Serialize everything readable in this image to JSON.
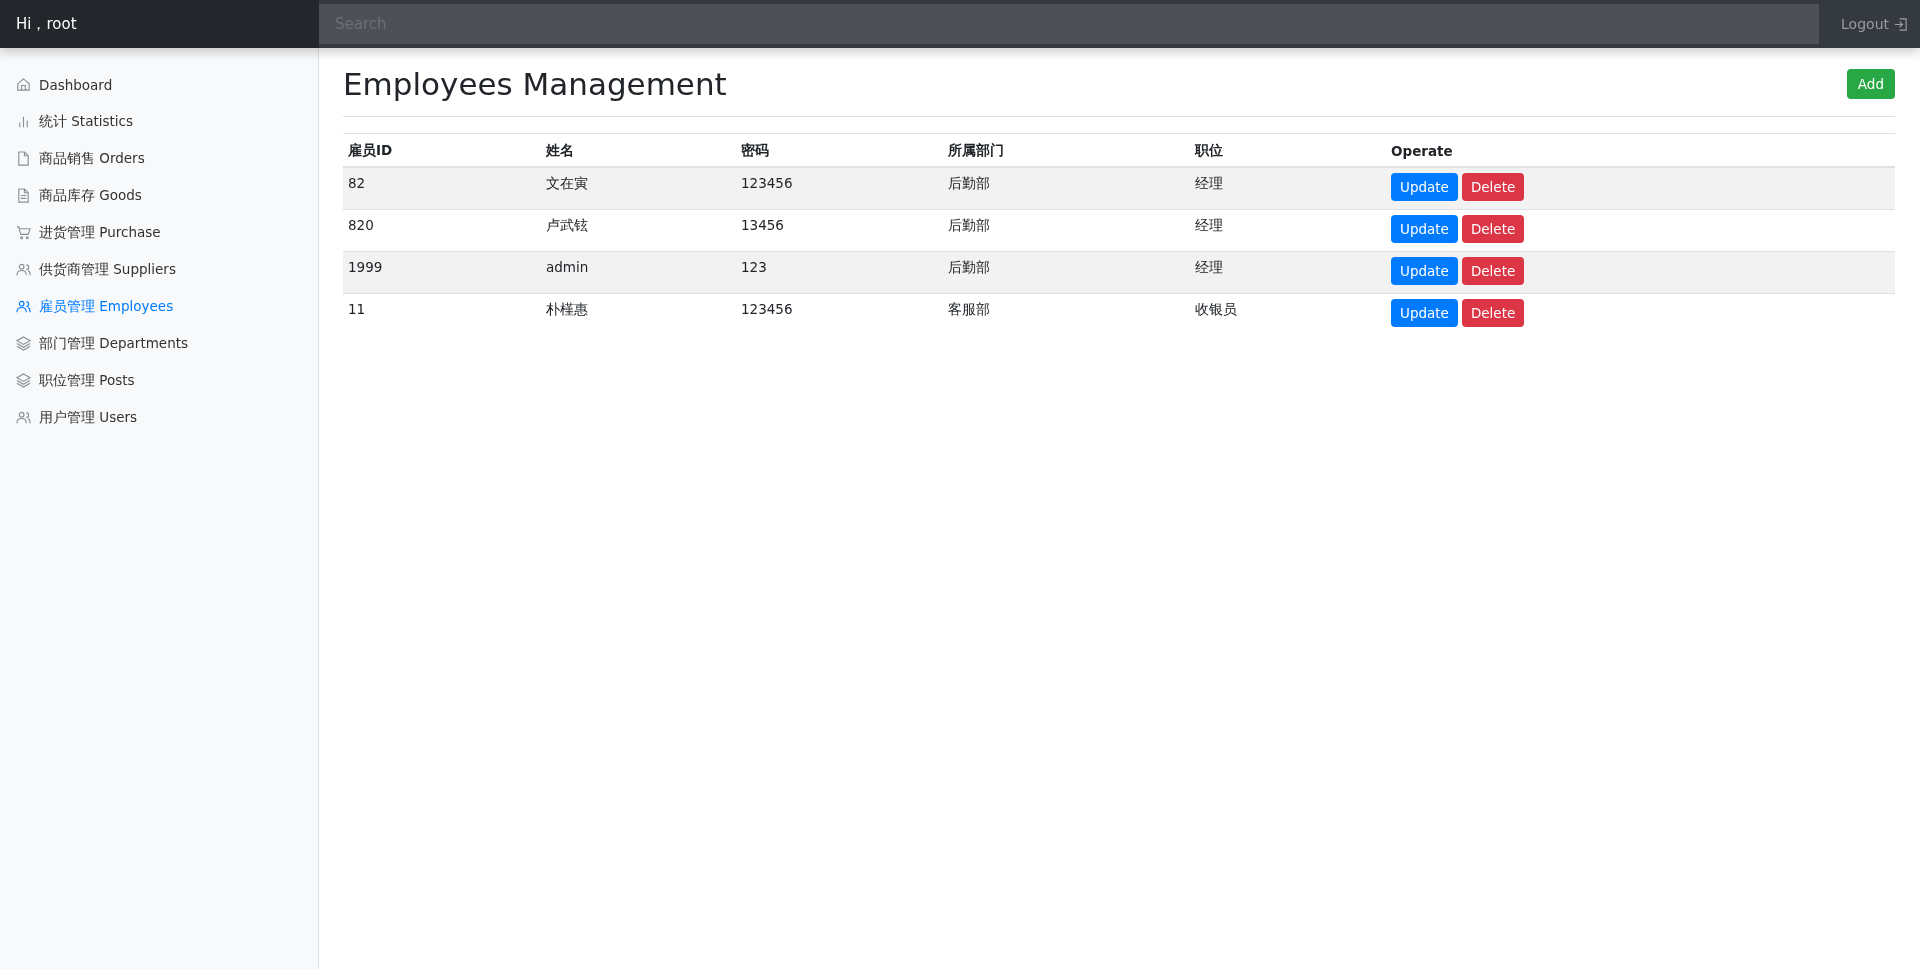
{
  "navbar": {
    "greeting": "Hi，root",
    "search": {
      "placeholder": "Search"
    },
    "logout": "Logout"
  },
  "sidebar": {
    "items": [
      {
        "label": "Dashboard",
        "kind": "home",
        "selected": false
      },
      {
        "label": "统计 Statistics",
        "kind": "chart",
        "selected": false
      },
      {
        "label": "商品销售 Orders",
        "kind": "file",
        "selected": false
      },
      {
        "label": "商品库存 Goods",
        "kind": "doc",
        "selected": false
      },
      {
        "label": "进货管理 Purchase",
        "kind": "cart",
        "selected": false
      },
      {
        "label": "供货商管理 Suppliers",
        "kind": "users",
        "selected": false
      },
      {
        "label": "雇员管理 Employees",
        "kind": "users",
        "selected": true
      },
      {
        "label": "部门管理 Departments",
        "kind": "layers",
        "selected": false
      },
      {
        "label": "职位管理 Posts",
        "kind": "layers",
        "selected": false
      },
      {
        "label": "用户管理 Users",
        "kind": "users",
        "selected": false
      }
    ]
  },
  "page": {
    "title": "Employees Management",
    "add_button": "Add"
  },
  "table": {
    "columns": [
      "雇员ID",
      "姓名",
      "密码",
      "所属部门",
      "职位",
      "Operate"
    ],
    "rows": [
      {
        "cells": [
          "82",
          "文在寅",
          "123456",
          "后勤部",
          "经理"
        ],
        "actions": [
          "Update",
          "Delete"
        ]
      },
      {
        "cells": [
          "820",
          "卢武铉",
          "13456",
          "后勤部",
          "经理"
        ],
        "actions": [
          "Update",
          "Delete"
        ]
      },
      {
        "cells": [
          "1999",
          "admin",
          "123",
          "后勤部",
          "经理"
        ],
        "actions": [
          "Update",
          "Delete"
        ]
      },
      {
        "cells": [
          "11",
          "朴槿惠",
          "123456",
          "客服部",
          "收银员"
        ],
        "actions": [
          "Update",
          "Delete"
        ]
      }
    ]
  }
}
